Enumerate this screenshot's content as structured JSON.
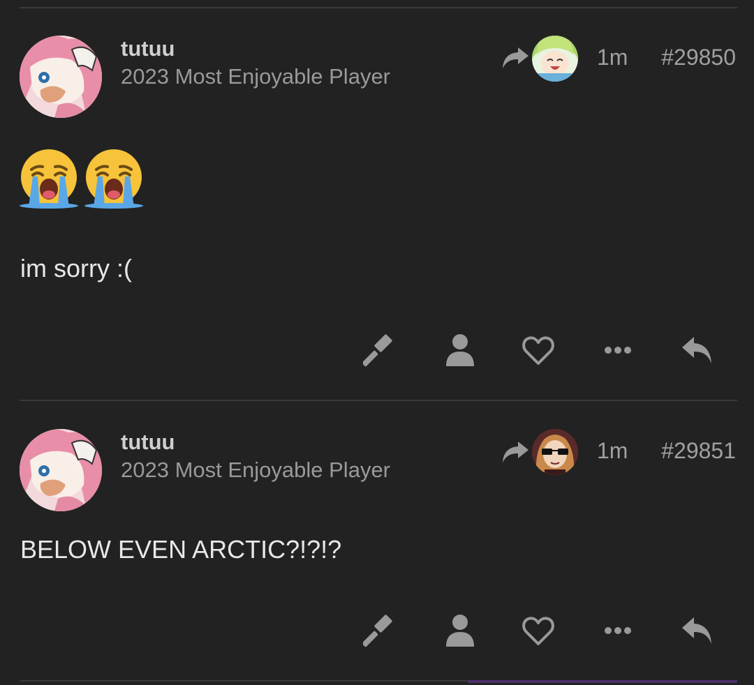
{
  "posts": [
    {
      "username": "tutuu",
      "user_title": "2023 Most Enjoyable Player",
      "time": "1m",
      "post_number": "#29850",
      "emojis": [
        "loudly-crying-face",
        "loudly-crying-face"
      ],
      "text": "im sorry :("
    },
    {
      "username": "tutuu",
      "user_title": "2023 Most Enjoyable Player",
      "time": "1m",
      "post_number": "#29851",
      "text": "BELOW EVEN ARCTIC?!?!?"
    }
  ],
  "actions": [
    "gavel-icon",
    "user-icon",
    "heart-icon",
    "more-icon",
    "reply-icon"
  ],
  "colors": {
    "background": "#222222",
    "divider": "#3a3a3a",
    "icon": "#9a9a9a",
    "text": "#e8e8e8",
    "muted": "#9a9a9a"
  }
}
